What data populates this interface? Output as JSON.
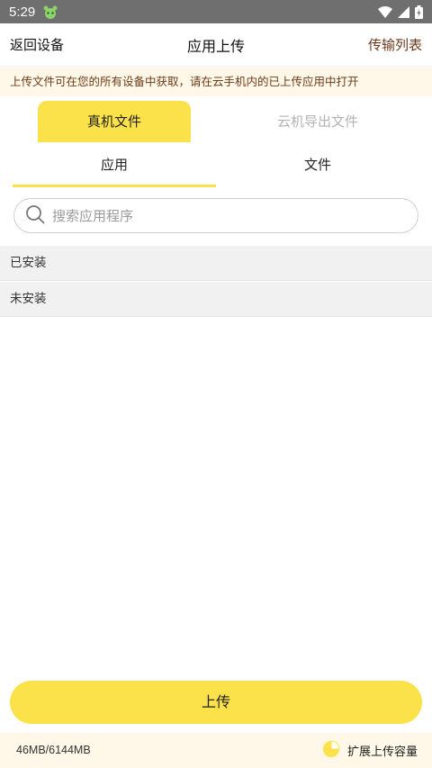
{
  "status_bar": {
    "time": "5:29",
    "icons": [
      "android-robot-icon",
      "wifi-icon",
      "cellular-signal-icon",
      "battery-icon"
    ]
  },
  "top_bar": {
    "back_label": "返回设备",
    "title": "应用上传",
    "transfer_list_label": "传输列表"
  },
  "notice": {
    "text": "上传文件可在您的所有设备中获取，请在云手机内的已上传应用中打开"
  },
  "source_tabs": [
    {
      "label": "真机文件",
      "active": true
    },
    {
      "label": "云机导出文件",
      "active": false
    }
  ],
  "type_tabs": [
    {
      "label": "应用",
      "active": true
    },
    {
      "label": "文件",
      "active": false
    }
  ],
  "search": {
    "placeholder": "搜索应用程序"
  },
  "groups": [
    {
      "label": "已安装"
    },
    {
      "label": "未安装"
    }
  ],
  "upload_button": {
    "label": "上传"
  },
  "footer": {
    "capacity": "46MB/6144MB",
    "expand_label": "扩展上传容量",
    "used_fraction": 0.0075
  },
  "colors": {
    "accent_yellow": "#fce24a",
    "notice_bg": "#fff8e8",
    "brown_text": "#6b3a1a",
    "status_bar_bg": "#6f6f6f"
  }
}
